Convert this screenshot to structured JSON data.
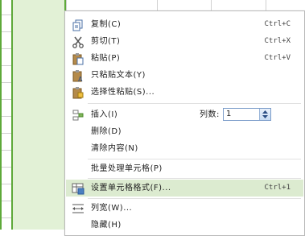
{
  "menu": {
    "items": [
      {
        "label": "复制(C)",
        "shortcut": "Ctrl+C",
        "icon": "copy-icon"
      },
      {
        "label": "剪切(T)",
        "shortcut": "Ctrl+X",
        "icon": "cut-icon"
      },
      {
        "label": "粘贴(P)",
        "shortcut": "Ctrl+V",
        "icon": "paste-icon"
      },
      {
        "label": "只粘贴文本(Y)",
        "shortcut": "",
        "icon": "paste-text-icon"
      },
      {
        "label": "选择性粘贴(S)...",
        "shortcut": "",
        "icon": "paste-special-icon"
      },
      {
        "label": "插入(I)",
        "shortcut": "",
        "icon": "insert-icon"
      },
      {
        "label": "删除(D)",
        "shortcut": "",
        "icon": ""
      },
      {
        "label": "清除内容(N)",
        "shortcut": "",
        "icon": ""
      },
      {
        "label": "批量处理单元格(P)",
        "shortcut": "",
        "icon": ""
      },
      {
        "label": "设置单元格格式(F)...",
        "shortcut": "Ctrl+1",
        "icon": "format-cells-icon"
      },
      {
        "label": "列宽(W)...",
        "shortcut": "",
        "icon": "column-width-icon"
      },
      {
        "label": "隐藏(H)",
        "shortcut": "",
        "icon": ""
      }
    ],
    "insert_count_label": "列数:",
    "insert_count_value": "1"
  },
  "colors": {
    "accent": "#5ea93a",
    "highlight": "#dcebd0",
    "selection_fill": "#e2f1d6"
  }
}
